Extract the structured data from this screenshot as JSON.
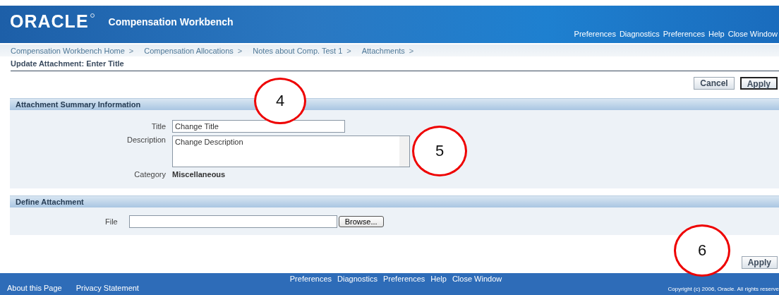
{
  "header": {
    "logo": "ORACLE",
    "app_title": "Compensation Workbench",
    "global_links": [
      "Preferences",
      "Diagnostics",
      "Preferences",
      "Help",
      "Close Window"
    ]
  },
  "breadcrumbs": [
    "Compensation Workbench Home",
    "Compensation Allocations",
    "Notes about Comp. Test 1",
    "Attachments"
  ],
  "breadcrumb_separator": ">",
  "page_title": "Update Attachment: Enter Title",
  "top_buttons": [
    {
      "label": "Cancel",
      "kind": "normal"
    },
    {
      "label": "Apply",
      "kind": "default"
    }
  ],
  "summary_section": {
    "heading": "Attachment Summary Information",
    "title_label": "Title",
    "title_value": "Change Title",
    "description_label": "Description",
    "description_value": "Change Description",
    "category_label": "Category",
    "category_value": "Miscellaneous"
  },
  "define_section": {
    "heading": "Define Attachment",
    "file_label": "File",
    "browse_button": "Browse..."
  },
  "bottom_buttons": [
    "Apply"
  ],
  "callouts": [
    "4",
    "5",
    "6"
  ],
  "footer": {
    "links": [
      "Preferences",
      "Diagnostics",
      "Preferences",
      "Help",
      "Close Window"
    ],
    "about": "About this Page",
    "privacy": "Privacy Statement",
    "copyright": "Copyright (c) 2006, Oracle. All rights reserve"
  }
}
